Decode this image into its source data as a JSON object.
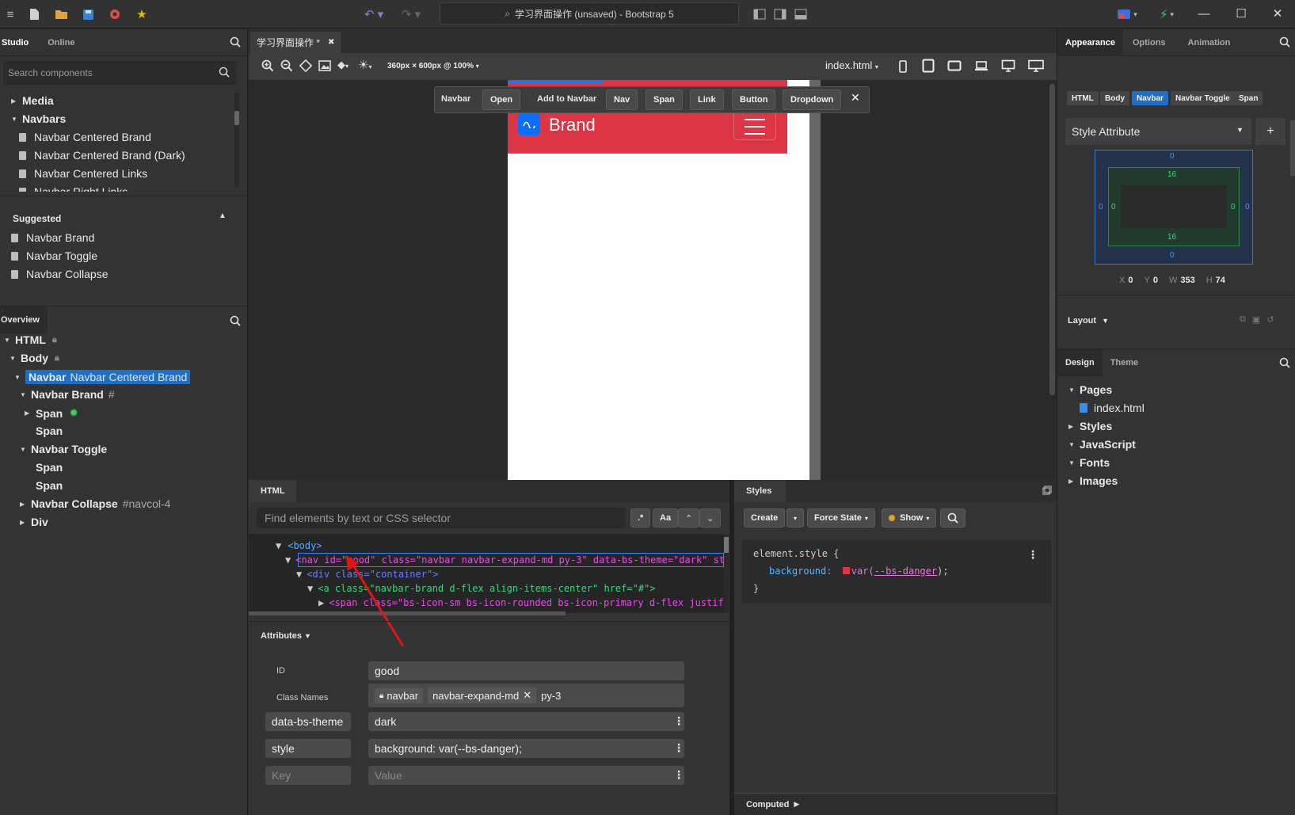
{
  "window": {
    "title": "学习界面操作 (unsaved) - Bootstrap 5",
    "minimize": "—",
    "maximize": "☐",
    "close": "✕"
  },
  "left": {
    "tabs": [
      "Studio",
      "Online"
    ],
    "search_placeholder": "Search components",
    "components": [
      {
        "label": "Media",
        "kind": "group-collapsed"
      },
      {
        "label": "Navbars",
        "kind": "group-open"
      },
      {
        "label": "Navbar Centered Brand",
        "kind": "item"
      },
      {
        "label": "Navbar Centered Brand (Dark)",
        "kind": "item"
      },
      {
        "label": "Navbar Centered Links",
        "kind": "item"
      },
      {
        "label": "Navbar Right Links",
        "kind": "item"
      }
    ],
    "suggested_title": "Suggested",
    "suggested": [
      "Navbar Brand",
      "Navbar Toggle",
      "Navbar Collapse"
    ],
    "overview_tab": "Overview",
    "overview": [
      {
        "label": "HTML",
        "extra": ""
      },
      {
        "label": "Body",
        "extra": ""
      },
      {
        "label": "Navbar",
        "extra": "Navbar Centered Brand"
      },
      {
        "label": "Navbar Brand",
        "extra": "#"
      },
      {
        "label": "Span",
        "extra": ""
      },
      {
        "label": "Span",
        "extra": ""
      },
      {
        "label": "Navbar Toggle",
        "extra": ""
      },
      {
        "label": "Span",
        "extra": ""
      },
      {
        "label": "Span",
        "extra": ""
      },
      {
        "label": "Navbar Collapse",
        "extra": "#navcol-4"
      },
      {
        "label": "Div",
        "extra": ""
      }
    ]
  },
  "center": {
    "doc_tab": "学习界面操作 *",
    "viewport_info": "360px × 600px @ 100%",
    "page_select": "index.html",
    "element_toolbar": [
      "Navbar",
      "Open",
      "Add to Navbar",
      "Nav",
      "Span",
      "Link",
      "Button",
      "Dropdown"
    ],
    "preview": {
      "brand": "Brand",
      "navbar_color": "#dc3545",
      "brand_icon_color": "#0d6efd"
    }
  },
  "html_panel": {
    "tab": "HTML",
    "find_placeholder": "Find elements by text or CSS selector",
    "regex_btn": ".*",
    "case_btn": "Aa",
    "code": [
      "<body>",
      "<nav id=\"good\" class=\"navbar navbar-expand-md py-3\" data-bs-theme=\"dark\" style=\"backgro",
      "<div class=\"container\">",
      "<a class=\"navbar-brand d-flex align-items-center\" href=\"#\">",
      "<span class=\"bs-icon-sm bs-icon-rounded bs-icon-primary d-flex justify-content-center"
    ]
  },
  "attributes": {
    "title": "Attributes",
    "id_label": "ID",
    "id_value": "good",
    "class_label": "Class Names",
    "classes": [
      "navbar",
      "navbar-expand-md",
      "py-3"
    ],
    "rows": [
      {
        "key": "data-bs-theme",
        "value": "dark"
      },
      {
        "key": "style",
        "value": "background: var(--bs-danger);"
      }
    ],
    "key_placeholder": "Key",
    "value_placeholder": "Value"
  },
  "styles_panel": {
    "tab": "Styles",
    "create": "Create",
    "force_state": "Force State",
    "show": "Show",
    "selector": "element.style {",
    "prop": "background:",
    "value_fn": "var(",
    "value_var": "--bs-danger",
    "value_end": ");",
    "close_brace": "}",
    "swatch": "#dc3545",
    "computed": "Computed"
  },
  "right": {
    "tabs": [
      "Appearance",
      "Options",
      "Animation"
    ],
    "breadcrumbs": [
      "HTML",
      "Body",
      "Navbar",
      "Navbar Toggle",
      "Span"
    ],
    "style_attr": "Style Attribute",
    "box": {
      "margin_top": "0",
      "margin_bottom": "0",
      "margin_left": "0",
      "margin_right": "0",
      "padding_top": "16",
      "padding_bottom": "16",
      "padding_left": "0",
      "padding_right": "0"
    },
    "dims": {
      "x_label": "X",
      "x": "0",
      "y_label": "Y",
      "y": "0",
      "w_label": "W",
      "w": "353",
      "h_label": "H",
      "h": "74"
    },
    "layout": "Layout",
    "design_tabs": [
      "Design",
      "Theme"
    ],
    "design_tree": [
      "Pages",
      "index.html",
      "Styles",
      "JavaScript",
      "Fonts",
      "Images"
    ]
  }
}
